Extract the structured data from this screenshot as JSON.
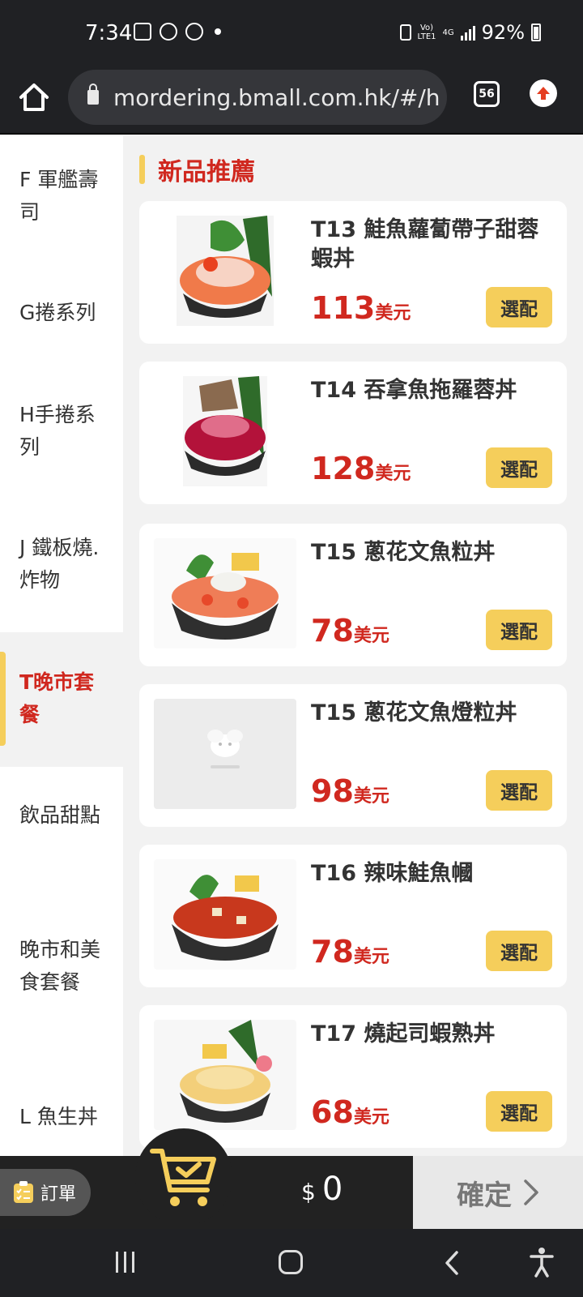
{
  "status_bar": {
    "time": "7:34",
    "network_top": "Vo)",
    "network_bottom": "LTE1",
    "network_type": "4G",
    "battery": "92%"
  },
  "browser": {
    "url": "mordering.bmall.com.hk/#/h",
    "tab_count": "56"
  },
  "sidebar": {
    "categories": [
      {
        "label": "F 軍艦壽司"
      },
      {
        "label": "G捲系列"
      },
      {
        "label": "H手捲系列"
      },
      {
        "label": "J 鐵板燒.炸物"
      },
      {
        "label": "T晚市套餐"
      },
      {
        "label": "飲品甜點"
      },
      {
        "label": "晚市和美食套餐"
      },
      {
        "label": "L 魚生丼"
      }
    ],
    "active_index": 4
  },
  "section": {
    "title": "新品推薦"
  },
  "products": [
    {
      "name": "T13 鮭魚蘿蔔帶子甜蓉蝦丼",
      "price": "113",
      "currency": "美元",
      "button": "選配"
    },
    {
      "name": "T14 吞拿魚拖羅蓉丼",
      "price": "128",
      "currency": "美元",
      "button": "選配"
    },
    {
      "name": "T15 蔥花文魚粒丼",
      "price": "78",
      "currency": "美元",
      "button": "選配"
    },
    {
      "name": "T15 蔥花文魚燈粒丼",
      "price": "98",
      "currency": "美元",
      "button": "選配"
    },
    {
      "name": "T16 辣味鮭魚幗",
      "price": "78",
      "currency": "美元",
      "button": "選配"
    },
    {
      "name": "T17 燒起司蝦熟丼",
      "price": "68",
      "currency": "美元",
      "button": "選配"
    }
  ],
  "cart": {
    "order_label": "訂單",
    "currency_symbol": "$",
    "total": "0",
    "confirm_label": "確定"
  },
  "colors": {
    "accent_red": "#d0281f",
    "accent_yellow": "#f5ce5b",
    "dark": "#222222"
  }
}
